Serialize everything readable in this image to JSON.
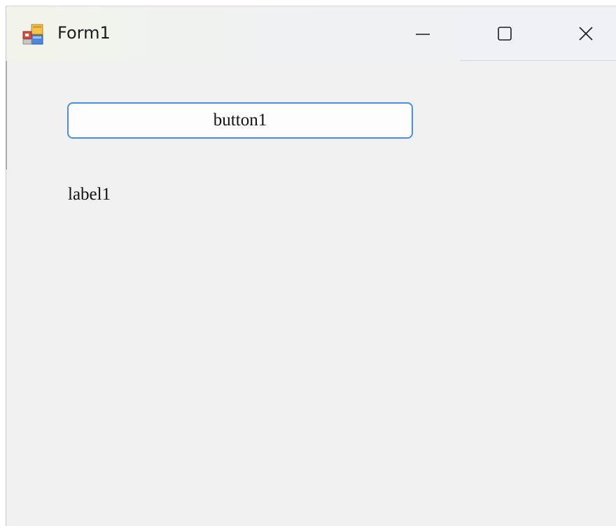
{
  "window": {
    "title": "Form1",
    "icon": "winforms-app-icon"
  },
  "titlebar_controls": {
    "minimize_icon": "minimize-icon",
    "maximize_icon": "maximize-icon",
    "close_icon": "close-icon"
  },
  "form": {
    "button1_label": "button1",
    "label1_text": "label1"
  },
  "colors": {
    "form_background": "#f0f0f0",
    "button_border_accent": "#4a8fd8",
    "titlebar_background": "#eef2f4"
  }
}
